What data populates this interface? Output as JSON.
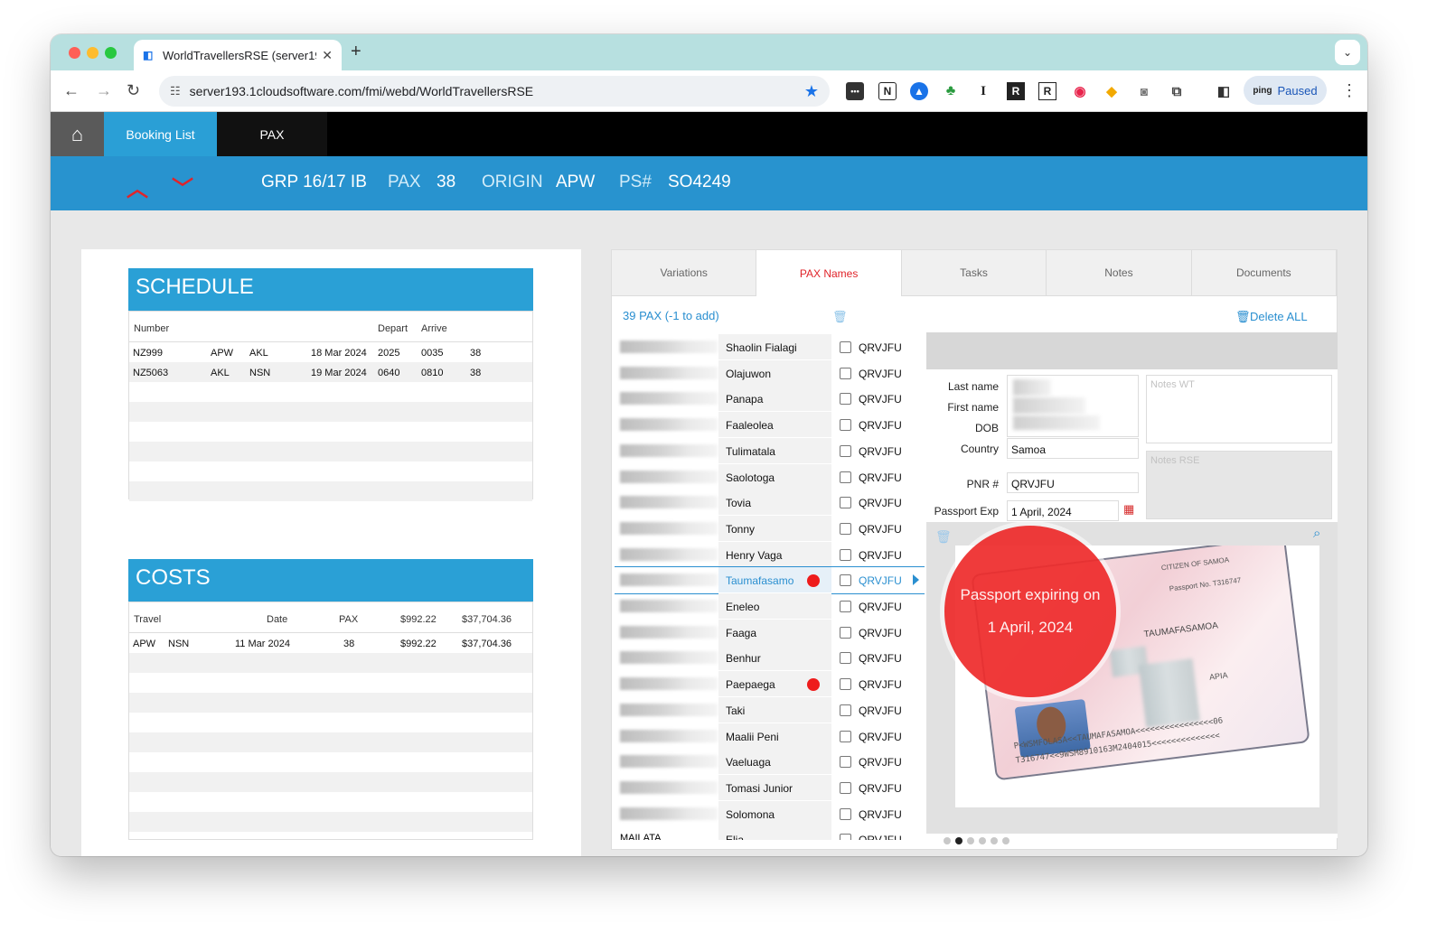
{
  "browser": {
    "tab_title": "WorldTravellersRSE (server19",
    "url": "server193.1cloudsoftware.com/fmi/webd/WorldTravellersRSE",
    "profile_status": "Paused",
    "profile_logo": "ping",
    "ext_letters": [
      "N",
      "I",
      "R",
      "R"
    ]
  },
  "app": {
    "tabs": [
      {
        "label": "Booking List",
        "active": true
      },
      {
        "label": "PAX",
        "active": false
      }
    ]
  },
  "header": {
    "group": "GRP 16/17 IB",
    "pax_label": "PAX",
    "pax_value": "38",
    "origin_label": "ORIGIN",
    "origin_value": "APW",
    "ps_label": "PS#",
    "ps_value": "SO4249"
  },
  "schedule": {
    "title": "SCHEDULE",
    "columns": [
      "Number",
      "Depart",
      "Arrive"
    ],
    "rows": [
      [
        "NZ999",
        "APW",
        "AKL",
        "18 Mar 2024",
        "2025",
        "0035",
        "38"
      ],
      [
        "NZ5063",
        "AKL",
        "NSN",
        "19 Mar 2024",
        "0640",
        "0810",
        "38"
      ]
    ]
  },
  "costs": {
    "title": "COSTS",
    "columns": [
      "Travel",
      "Date",
      "PAX",
      "$992.22",
      "$37,704.36"
    ],
    "rows": [
      [
        "APW",
        "NSN",
        "11 Mar 2024",
        "38",
        "$992.22",
        "$37,704.36"
      ]
    ]
  },
  "right_tabs": [
    {
      "label": "Variations",
      "active": false
    },
    {
      "label": "PAX Names",
      "active": true
    },
    {
      "label": "Tasks",
      "active": false
    },
    {
      "label": "Notes",
      "active": false
    },
    {
      "label": "Documents",
      "active": false
    }
  ],
  "pax_count": "39 PAX (-1 to add)",
  "delete_all": "Delete ALL",
  "pax": [
    {
      "name": "Shaolin Fialagi",
      "pnr": "QRVJFU",
      "flag": false,
      "selected": false
    },
    {
      "name": "Olajuwon",
      "pnr": "QRVJFU",
      "flag": false,
      "selected": false
    },
    {
      "name": "Panapa",
      "pnr": "QRVJFU",
      "flag": false,
      "selected": false
    },
    {
      "name": "Faaleolea",
      "pnr": "QRVJFU",
      "flag": false,
      "selected": false
    },
    {
      "name": "Tulimatala",
      "pnr": "QRVJFU",
      "flag": false,
      "selected": false
    },
    {
      "name": "Saolotoga",
      "pnr": "QRVJFU",
      "flag": false,
      "selected": false
    },
    {
      "name": "Tovia",
      "pnr": "QRVJFU",
      "flag": false,
      "selected": false
    },
    {
      "name": "Tonny",
      "pnr": "QRVJFU",
      "flag": false,
      "selected": false
    },
    {
      "name": "Henry Vaga",
      "pnr": "QRVJFU",
      "flag": false,
      "selected": false
    },
    {
      "name": "Taumafasamo",
      "pnr": "QRVJFU",
      "flag": true,
      "selected": true
    },
    {
      "name": "Eneleo",
      "pnr": "QRVJFU",
      "flag": false,
      "selected": false
    },
    {
      "name": "Faaga",
      "pnr": "QRVJFU",
      "flag": false,
      "selected": false
    },
    {
      "name": "Benhur",
      "pnr": "QRVJFU",
      "flag": false,
      "selected": false
    },
    {
      "name": "Paepaega",
      "pnr": "QRVJFU",
      "flag": true,
      "selected": false
    },
    {
      "name": "Taki",
      "pnr": "QRVJFU",
      "flag": false,
      "selected": false
    },
    {
      "name": "Maalii Peni",
      "pnr": "QRVJFU",
      "flag": false,
      "selected": false
    },
    {
      "name": "Vaeluaga",
      "pnr": "QRVJFU",
      "flag": false,
      "selected": false
    },
    {
      "name": "Tomasi Junior",
      "pnr": "QRVJFU",
      "flag": false,
      "selected": false
    },
    {
      "name": "Solomona",
      "pnr": "QRVJFU",
      "flag": false,
      "selected": false
    },
    {
      "name": "Elia",
      "pnr": "QRVJFU",
      "flag": false,
      "selected": false,
      "surname": "MAILATA"
    }
  ],
  "detail": {
    "last_name_label": "Last name",
    "first_name_label": "First name",
    "dob_label": "DOB",
    "country_label": "Country",
    "country_value": "Samoa",
    "pnr_label": "PNR #",
    "pnr_value": "QRVJFU",
    "passport_exp_label": "Passport Exp",
    "passport_exp_value": "1 April, 2024",
    "notes_wt_placeholder": "Notes WT",
    "notes_rse_placeholder": "Notes RSE",
    "alert_line1": "Passport expiring on",
    "alert_line2": "1 April, 2024",
    "passport_text": {
      "citizen": "CITIZEN OF SAMOA",
      "passport_no": "Passport No. T316747",
      "name": "TAUMAFASAMOA",
      "place": "APIA",
      "mrz1": "P<WSMFOLASA<<TAUMAFASAMOA<<<<<<<<<<<<<<<<06",
      "mrz2": "T316747<<9WSM8910163M2404015<<<<<<<<<<<<<<"
    }
  },
  "pager": {
    "count": 6,
    "active": 1
  },
  "colors": {
    "accent_blue": "#2893cf",
    "alert_red": "#ee1c1c",
    "link_blue": "#2a8fd0"
  }
}
